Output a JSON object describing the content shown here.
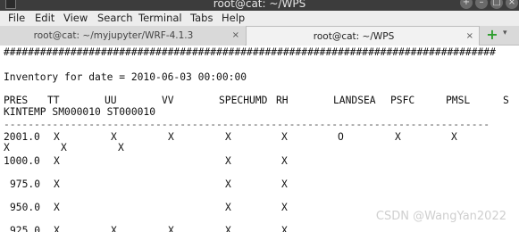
{
  "window": {
    "title": "root@cat: ~/WPS",
    "buttons": [
      "+",
      "–",
      "□",
      "×"
    ]
  },
  "menu": [
    "File",
    "Edit",
    "View",
    "Search",
    "Terminal",
    "Tabs",
    "Help"
  ],
  "tabs": [
    {
      "label": "root@cat: ~/myjupyter/WRF-4.1.3",
      "close": "×"
    },
    {
      "label": "root@cat: ~/WPS",
      "close": "×"
    }
  ],
  "tab_controls": {
    "new_tab": "+",
    "menu": "▾"
  },
  "terminal": {
    "hash_line": "#################################################################################",
    "inventory_line": "Inventory for date = 2010-06-03 00:00:00",
    "header1": [
      "PRES",
      "TT",
      "UU",
      "VV",
      "SPECHUMD",
      "RH",
      "LANDSEA",
      "PSFC",
      "PMSL",
      "S"
    ],
    "header2": "KINTEMP SM000010 ST000010",
    "dash_line": "--------------------------------------------------------------------------------",
    "row_2001": {
      "pres": "2001.0",
      "marks": [
        "X",
        "X",
        "X",
        "X",
        "X",
        "O",
        "X",
        "X"
      ]
    },
    "row_2001_wrap": [
      "X",
      "X",
      "X"
    ],
    "row_1000": {
      "pres": "1000.0",
      "marks": [
        "X",
        "X",
        "X"
      ]
    },
    "row_975": {
      "pres": "975.0",
      "marks": [
        "X",
        "X",
        "X"
      ]
    },
    "row_950": {
      "pres": "950.0",
      "marks": [
        "X",
        "X",
        "X"
      ]
    },
    "row_925": {
      "pres": "925.0",
      "marks": [
        "X",
        "X",
        "X",
        "X",
        "X"
      ]
    }
  },
  "watermark": "CSDN @WangYan2022"
}
